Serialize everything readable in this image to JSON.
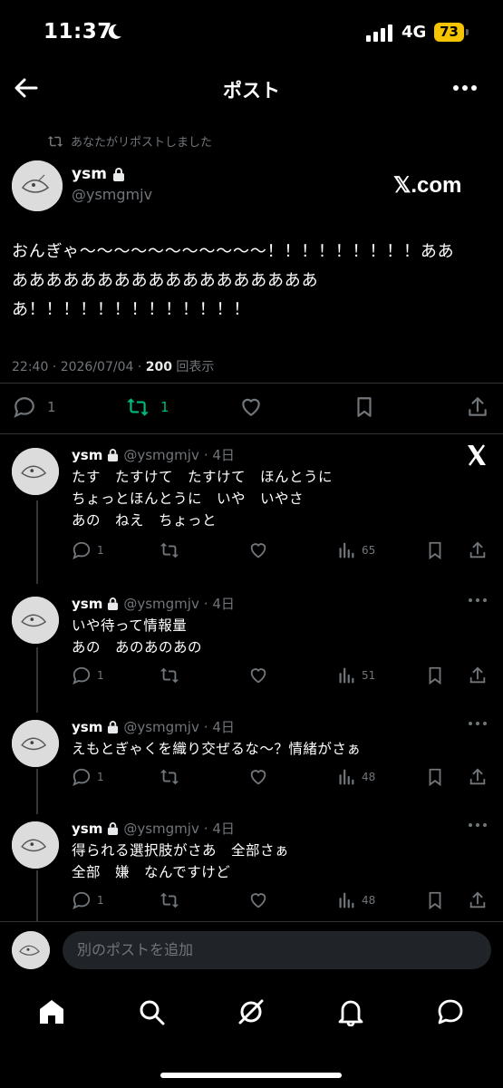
{
  "status_bar": {
    "time": "11:37",
    "network": "4G",
    "battery": "73"
  },
  "header": {
    "title": "ポスト"
  },
  "post": {
    "repost_note": "あなたがリポストしました",
    "name": "ysm",
    "handle": "@ysmgmjv",
    "source_logo": "𝕏.com",
    "text": "おんぎゃ〜〜〜〜〜〜〜〜〜〜〜！！！！！！！！！ああ\nああああああああああああああああああ\nあ！！！！！！！！！！！！！",
    "timestamp": "22:40 · 2026/07/04 · ",
    "views": "200",
    "views_label": " 回表示",
    "reply_count": "1",
    "repost_count": "1"
  },
  "replies": [
    {
      "name": "ysm",
      "handle": "@ysmgmjv",
      "age": "· 4日",
      "text": "たす　たすけて　たすけて　ほんとうに\nちょっとほんとうに　いや　いやさ\nあの　ねえ　ちょっと",
      "replies": "1",
      "views": "65"
    },
    {
      "name": "ysm",
      "handle": "@ysmgmjv",
      "age": "· 4日",
      "text": "いや待って情報量\nあの　あのあのあの",
      "replies": "1",
      "views": "51"
    },
    {
      "name": "ysm",
      "handle": "@ysmgmjv",
      "age": "· 4日",
      "text": "えもとぎゃくを織り交ぜるな〜？情緒がさぁ",
      "replies": "1",
      "views": "48"
    },
    {
      "name": "ysm",
      "handle": "@ysmgmjv",
      "age": "· 4日",
      "text": "得られる選択肢がさあ　全部さぁ\n全部　嫌　なんですけど",
      "replies": "1",
      "views": "48"
    }
  ],
  "composer": {
    "placeholder": "別のポストを追加"
  },
  "icons": {
    "back": "arrow-left-icon",
    "more": "more-dots-icon",
    "lock": "lock-icon",
    "reply": "reply-icon",
    "repost": "repost-icon",
    "like": "heart-icon",
    "bookmark": "bookmark-icon",
    "share": "share-icon",
    "views": "analytics-icon",
    "nav": [
      "home-icon",
      "search-icon",
      "grok-icon",
      "bell-icon",
      "messages-icon"
    ]
  },
  "colors": {
    "background": "#000000",
    "text": "#e7e9ea",
    "muted": "#71767b",
    "repost_green": "#00ba7c",
    "battery": "#f5c400"
  }
}
